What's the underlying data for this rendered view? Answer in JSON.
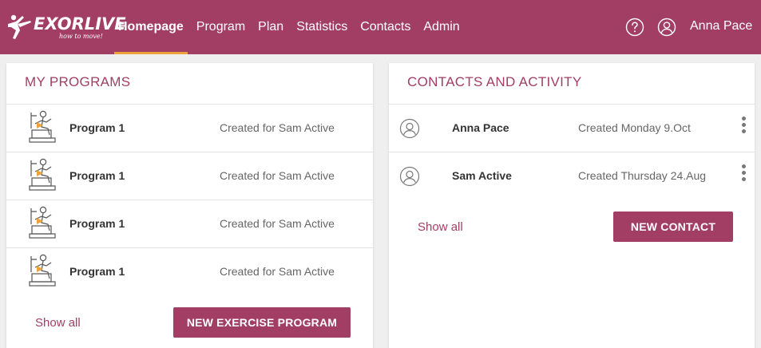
{
  "header": {
    "logo_text": "EXORLIVE",
    "logo_tagline": "how to move!",
    "nav": [
      {
        "label": "Homepage",
        "active": true
      },
      {
        "label": "Program",
        "active": false
      },
      {
        "label": "Plan",
        "active": false
      },
      {
        "label": "Statistics",
        "active": false
      },
      {
        "label": "Contacts",
        "active": false
      },
      {
        "label": "Admin",
        "active": false
      }
    ],
    "help_icon": "help-circle-icon",
    "user_icon": "user-circle-icon",
    "user_name": "Anna Pace"
  },
  "programs": {
    "title": "MY PROGRAMS",
    "items": [
      {
        "name": "Program 1",
        "meta": "Created for Sam Active"
      },
      {
        "name": "Program 1",
        "meta": "Created for Sam Active"
      },
      {
        "name": "Program 1",
        "meta": "Created for Sam Active"
      },
      {
        "name": "Program 1",
        "meta": "Created for Sam Active"
      }
    ],
    "show_all": "Show all",
    "new_button": "NEW EXERCISE PROGRAM"
  },
  "contacts": {
    "title": "CONTACTS AND ACTIVITY",
    "items": [
      {
        "name": "Anna Pace",
        "meta": "Created Monday 9.Oct"
      },
      {
        "name": "Sam Active",
        "meta": "Created Thursday 24.Aug"
      }
    ],
    "show_all": "Show all",
    "new_button": "NEW CONTACT"
  },
  "colors": {
    "brand": "#a23e64",
    "accent": "#f0a23a",
    "background": "#efefef"
  }
}
